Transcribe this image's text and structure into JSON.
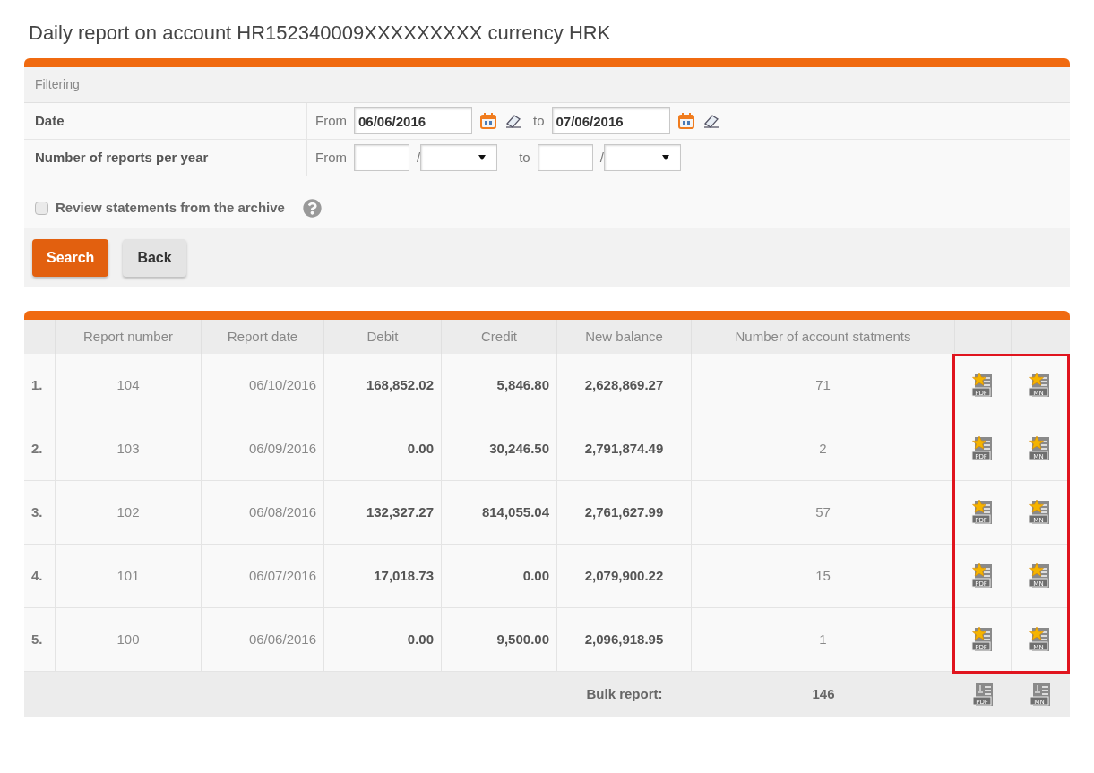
{
  "title": "Daily report on account HR152340009XXXXXXXXX currency HRK",
  "filter": {
    "heading": "Filtering",
    "date": {
      "label": "Date",
      "from_label": "From",
      "from_value": "06/06/2016",
      "to_label": "to",
      "to_value": "07/06/2016"
    },
    "reports": {
      "label": "Number of reports per year",
      "from_label": "From",
      "separator_from": "/",
      "to_label": "to",
      "separator_to": "/"
    },
    "archive": {
      "label": "Review statements from the archive",
      "checked": false
    },
    "buttons": [
      {
        "label": "Search",
        "kind": "primary"
      },
      {
        "label": "Back",
        "kind": "secondary"
      }
    ]
  },
  "table": {
    "columns": [
      "Report number",
      "Report date",
      "Debit",
      "Credit",
      "New balance",
      "Number of account statments"
    ],
    "rows": [
      {
        "index": "1.",
        "number": "104",
        "date": "06/10/2016",
        "debit": "168,852.02",
        "credit": "5,846.80",
        "balance": "2,628,869.27",
        "statements": "71",
        "files": [
          {
            "label": "PDF",
            "starred": true
          },
          {
            "label": "MN",
            "starred": true
          }
        ]
      },
      {
        "index": "2.",
        "number": "103",
        "date": "06/09/2016",
        "debit": "0.00",
        "credit": "30,246.50",
        "balance": "2,791,874.49",
        "statements": "2",
        "files": [
          {
            "label": "PDF",
            "starred": true
          },
          {
            "label": "MN",
            "starred": true
          }
        ]
      },
      {
        "index": "3.",
        "number": "102",
        "date": "06/08/2016",
        "debit": "132,327.27",
        "credit": "814,055.04",
        "balance": "2,761,627.99",
        "statements": "57",
        "files": [
          {
            "label": "PDF",
            "starred": true
          },
          {
            "label": "MN",
            "starred": true
          }
        ]
      },
      {
        "index": "4.",
        "number": "101",
        "date": "06/07/2016",
        "debit": "17,018.73",
        "credit": "0.00",
        "balance": "2,079,900.22",
        "statements": "15",
        "files": [
          {
            "label": "PDF",
            "starred": true
          },
          {
            "label": "MN",
            "starred": true
          }
        ]
      },
      {
        "index": "5.",
        "number": "100",
        "date": "06/06/2016",
        "debit": "0.00",
        "credit": "9,500.00",
        "balance": "2,096,918.95",
        "statements": "1",
        "files": [
          {
            "label": "PDF",
            "starred": true
          },
          {
            "label": "MN",
            "starred": true
          }
        ]
      }
    ],
    "bulk": {
      "label": "Bulk report:",
      "total": "146",
      "files": [
        {
          "label": "PDF",
          "starred": false
        },
        {
          "label": "MN",
          "starred": false
        }
      ]
    },
    "highlighted": true
  }
}
